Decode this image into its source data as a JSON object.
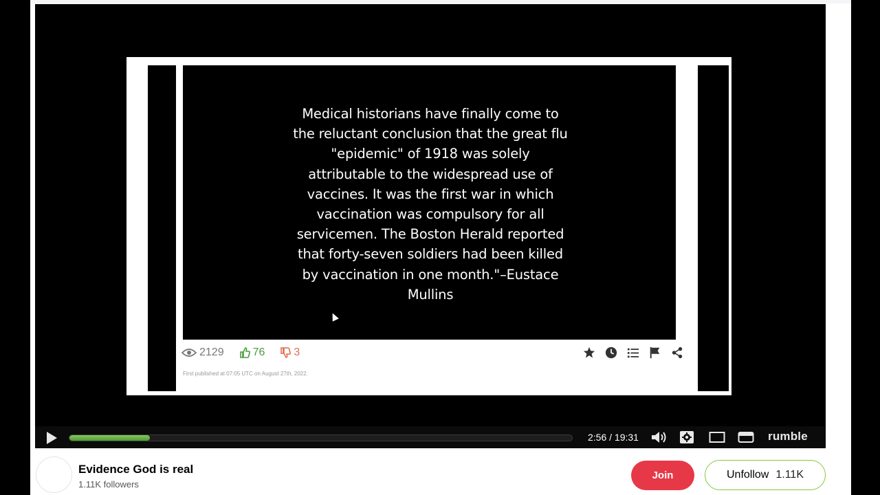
{
  "video": {
    "quote": "Medical historians have finally come to the reluctant conclusion that the great flu \"epidemic\" of 1918 was solely attributable to the widespread use of vaccines. It was the first war in which vaccination was compulsory for all servicemen. The Boston Herald reported that forty-seven soldiers had been killed by vaccination in one month.\"–Eustace Mullins",
    "views": "2129",
    "likes": "76",
    "dislikes": "3",
    "published": "First published at 07:05 UTC on August 27th, 2022."
  },
  "player": {
    "time": "2:56 / 19:31",
    "progress_percent": 16,
    "brand": "rumble",
    "accent_color": "#74c047"
  },
  "channel": {
    "name": "Evidence God is real",
    "followers": "1.11K followers",
    "join_label": "Join",
    "unfollow_label": "Unfollow",
    "unfollow_count": "1.11K"
  },
  "icons": [
    "eye-icon",
    "thumbs-up-icon",
    "thumbs-down-icon",
    "star-icon",
    "clock-icon",
    "list-icon",
    "flag-icon",
    "share-icon",
    "play-icon",
    "volume-icon",
    "settings-icon",
    "theater-mode-icon",
    "miniplayer-icon"
  ]
}
